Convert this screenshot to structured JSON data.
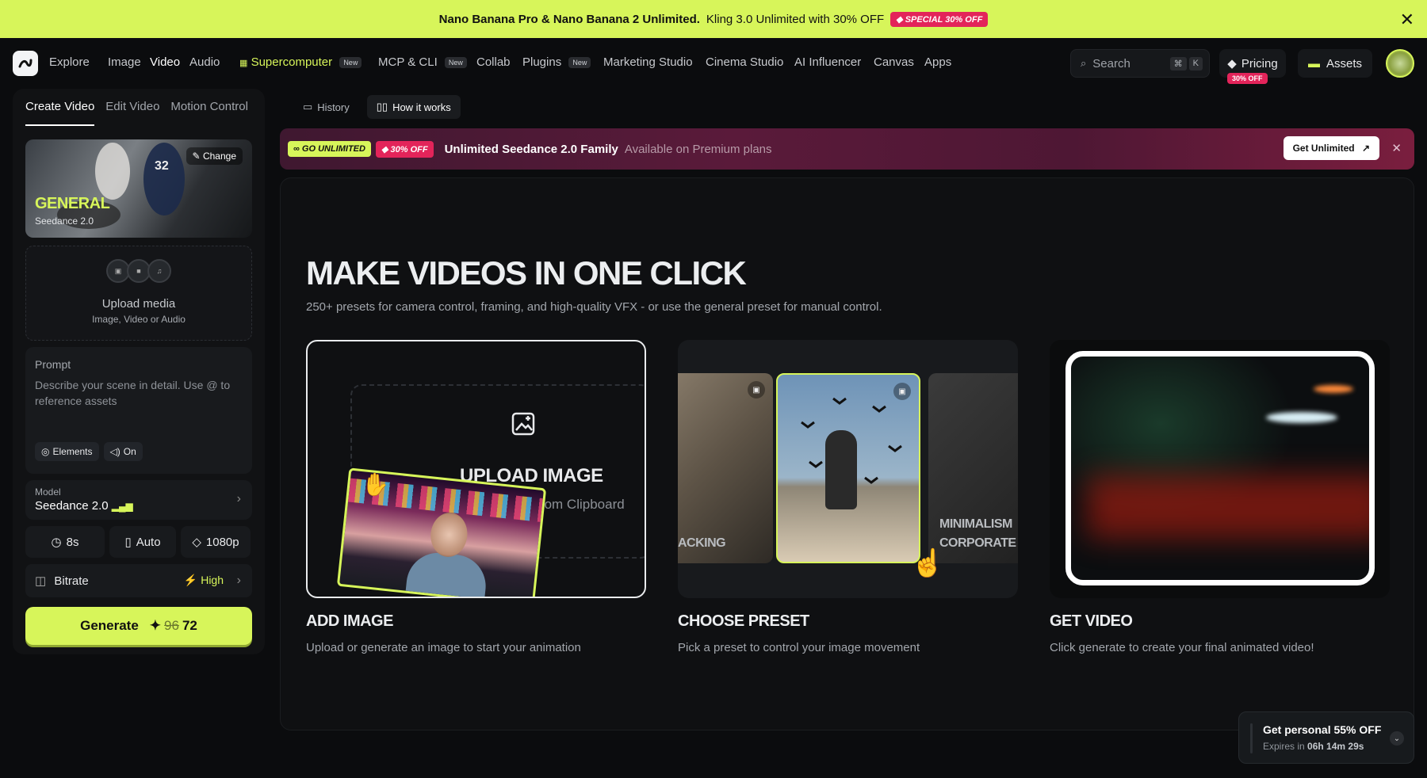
{
  "promo": {
    "bold": "Nano Banana Pro & Nano Banana 2 Unlimited.",
    "text": "Kling 3.0 Unlimited with 30% OFF",
    "badge": "SPECIAL 30% OFF"
  },
  "nav": {
    "items": [
      "Explore",
      "Image",
      "Video",
      "Audio",
      "Supercomputer",
      "MCP & CLI",
      "Collab",
      "Plugins",
      "Marketing Studio",
      "Cinema Studio",
      "AI Influencer",
      "Canvas",
      "Apps"
    ],
    "new_tag": "New",
    "search_placeholder": "Search",
    "kbd1": "⌘",
    "kbd2": "K",
    "pricing": "Pricing",
    "pricing_badge": "30% OFF",
    "assets": "Assets"
  },
  "left": {
    "tabs": [
      "Create Video",
      "Edit Video",
      "Motion Control"
    ],
    "preset_title": "GENERAL",
    "preset_sub": "Seedance 2.0",
    "change": "Change",
    "upload_title": "Upload media",
    "upload_sub": "Image, Video or Audio",
    "prompt_label": "Prompt",
    "prompt_placeholder": "Describe your scene in detail. Use @ to reference assets",
    "elements": "Elements",
    "audio": "On",
    "model_label": "Model",
    "model_value": "Seedance 2.0",
    "duration": "8s",
    "aspect": "Auto",
    "resolution": "1080p",
    "bitrate_label": "Bitrate",
    "bitrate_value": "High",
    "generate": "Generate",
    "cost_old": "96",
    "cost_new": "72"
  },
  "main": {
    "tabs": [
      "History",
      "How it works"
    ],
    "banner": {
      "badge1": "GO UNLIMITED",
      "badge2": "30% OFF",
      "title": "Unlimited Seedance 2.0 Family",
      "sub": "Available on Premium plans",
      "cta": "Get Unlimited"
    },
    "headline": "MAKE VIDEOS IN ONE CLICK",
    "subline": "250+ presets for camera control, framing, and high-quality VFX - or use the general preset for manual control.",
    "upload_title": "UPLOAD IMAGE",
    "upload_sub": "Paste from Clipboard",
    "preset_labels": [
      "ACKING",
      "MINIMALISM",
      "CORPORATE"
    ],
    "steps": [
      {
        "title": "ADD IMAGE",
        "desc": "Upload or generate an image to start your animation"
      },
      {
        "title": "CHOOSE PRESET",
        "desc": "Pick a preset to control your image movement"
      },
      {
        "title": "GET VIDEO",
        "desc": "Click generate to create your final animated video!"
      }
    ]
  },
  "toast": {
    "title": "Get personal 55% OFF",
    "expires_label": "Expires in",
    "expires_value": "06h 14m 29s"
  },
  "colors": {
    "accent": "#d7f55a",
    "pink": "#e3245a",
    "bg": "#0b0c0e"
  }
}
